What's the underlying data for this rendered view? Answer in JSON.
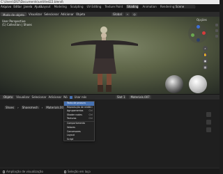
{
  "window": {
    "title": "C:\\Users\\DST\\Documents\\untitled22.blend\\"
  },
  "menu": [
    "Arquivo",
    "Editar",
    "Janela",
    "Ajuda"
  ],
  "workspaces": [
    "Layout",
    "Modeling",
    "Sculpting",
    "UV Editing",
    "Texture Paint",
    "Shading",
    "Animation",
    "Rendering",
    "Compositing",
    "Geometry",
    "Scripting"
  ],
  "active_workspace": "Shading",
  "scene": "Scene",
  "toolbar": {
    "mode": "Modo de objeto",
    "view": "Visualizar",
    "select": "Selecionar",
    "add": "Adicionar",
    "object": "Objeto",
    "transform": "Global"
  },
  "viewport": {
    "view_label": "User Perspective",
    "collection_label": "(1) Collection | Shoes",
    "options": "Opções"
  },
  "node_header": {
    "type": "Objeto",
    "view": "Visualizar",
    "select": "Selecionar",
    "add": "Adicionar",
    "node": "Nó",
    "use_nodes": "Usar nós",
    "slot": "Slot 1",
    "material": "Materials.007"
  },
  "breadcrumb": [
    "Shoes",
    "Shoesmesh",
    "Materials.007"
  ],
  "add_menu": {
    "items": [
      {
        "label": "Texto de procura",
        "shortcut": "",
        "highlight": true
      },
      {
        "label": "Reprodução de mídia",
        "shortcut": "Ctrl"
      },
      {
        "label": "Agrupamentos",
        "shortcut": "Ctrl"
      },
      {
        "label": "Shader nodes",
        "shortcut": "Ctrl"
      },
      {
        "label": "Texturas",
        "shortcut": "Ctrl"
      },
      {
        "label": "Comportamento",
        "shortcut": ""
      },
      {
        "label": "Vetores",
        "shortcut": ""
      },
      {
        "label": "Conversores",
        "shortcut": ""
      },
      {
        "label": "Layout",
        "shortcut": ""
      },
      {
        "label": "Script",
        "shortcut": ""
      },
      {
        "label": "Grupo",
        "shortcut": ""
      },
      {
        "label": "Nós ativos",
        "shortcut": ""
      },
      {
        "label": "Nós padrões",
        "shortcut": ""
      },
      {
        "label": "Texturas",
        "shortcut": ""
      }
    ]
  },
  "status_bar": {
    "left": "Ampliação de visualização",
    "right": "Seleção em laço"
  },
  "colors": {
    "accent": "#4772b3",
    "axis_x": "#d63b3b",
    "axis_y": "#6aa84f",
    "axis_z": "#3d6fd6"
  }
}
